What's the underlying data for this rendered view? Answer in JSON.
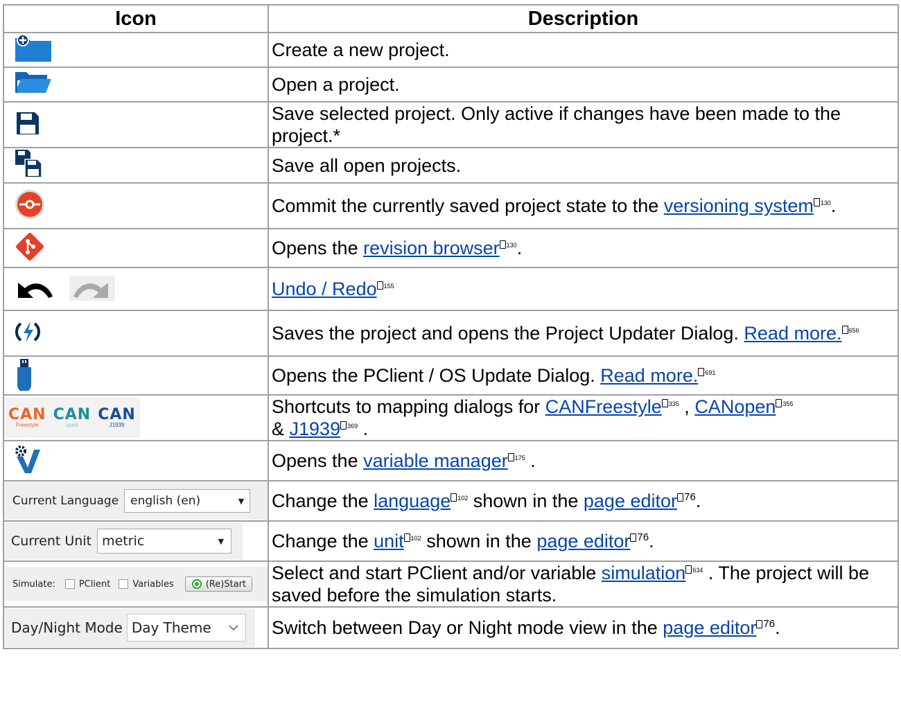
{
  "table": {
    "header_icon": "Icon",
    "header_description": "Description"
  },
  "rows": {
    "new_project": {
      "icon": "new-project-folder-icon",
      "text": "Create a new project."
    },
    "open_project": {
      "icon": "open-folder-icon",
      "text": "Open a project."
    },
    "save": {
      "icon": "save-disk-icon",
      "text": "Save selected project. Only active if changes have been made to the project.*"
    },
    "save_all": {
      "icon": "save-all-disks-icon",
      "text": "Save all open projects."
    },
    "commit": {
      "icon": "commit-icon",
      "text_before": "Commit the currently saved project state to the ",
      "link": "versioning system",
      "ref": "130",
      "text_after": "."
    },
    "revision": {
      "icon": "git-diamond-icon",
      "text_before": "Opens the ",
      "link": "revision browser",
      "ref": "130",
      "text_after": "."
    },
    "undo_redo": {
      "icon": "undo-redo-icon",
      "link": "Undo / Redo",
      "ref": "155"
    },
    "updater": {
      "icon": "lightning-updater-icon",
      "text_before": "Saves the project and opens the Project Updater Dialog. ",
      "link": "Read more.",
      "ref": "656"
    },
    "pclient": {
      "icon": "usb-stick-icon",
      "text_before": "Opens the PClient / OS Update Dialog. ",
      "link": "Read more.",
      "ref": "691"
    },
    "can": {
      "icons": [
        {
          "word": "CAN",
          "sub": "Freestyle",
          "color": "#e8672a",
          "subcolor": "#e8672a"
        },
        {
          "word": "CAN",
          "sub": "open",
          "color": "#1a8fa0",
          "subcolor": "#7fc6cf"
        },
        {
          "word": "CAN",
          "sub": "J1939",
          "color": "#1d4f8f",
          "subcolor": "#1d4f8f"
        }
      ],
      "text_before": "Shortcuts to mapping dialogs for ",
      "link1": "CANFreestyle",
      "ref1": "335",
      "sep": " , ",
      "link2": "CANopen",
      "ref2": "355",
      "amp": "& ",
      "link3": "J1939",
      "ref3": "369",
      "text_after": " ."
    },
    "variables": {
      "icon": "variable-manager-icon",
      "text_before": "Opens the ",
      "link": "variable manager",
      "ref": "175",
      "text_after": " ."
    },
    "language": {
      "label": "Current Language",
      "value": "english (en)",
      "text_before": "Change the ",
      "link1": "language",
      "ref1": "102",
      "text_mid": " shown in the ",
      "link2": "page editor",
      "ref2": "76",
      "text_after": "."
    },
    "unit": {
      "label": "Current Unit",
      "value": "metric",
      "text_before": "Change the ",
      "link1": "unit",
      "ref1": "102",
      "text_mid": " shown in the ",
      "link2": "page editor",
      "ref2": "76",
      "text_after": "."
    },
    "simulate": {
      "label": "Simulate:",
      "opt1": "PClient",
      "opt2": "Variables",
      "button": "(Re)Start",
      "text_before": "Select and start PClient and/or variable ",
      "link": "simulation",
      "ref": "634",
      "text_after": " . The project will be saved before the simulation starts."
    },
    "daynight": {
      "label": "Day/Night Mode",
      "value": "Day Theme",
      "text_before": "Switch between Day or Night mode view in the ",
      "link": "page editor",
      "ref": "76",
      "text_after": "."
    }
  },
  "colors": {
    "link": "#0645ad",
    "border": "#a0a0a0",
    "icon_blue": "#1f6fb8",
    "icon_red": "#e2412a"
  }
}
